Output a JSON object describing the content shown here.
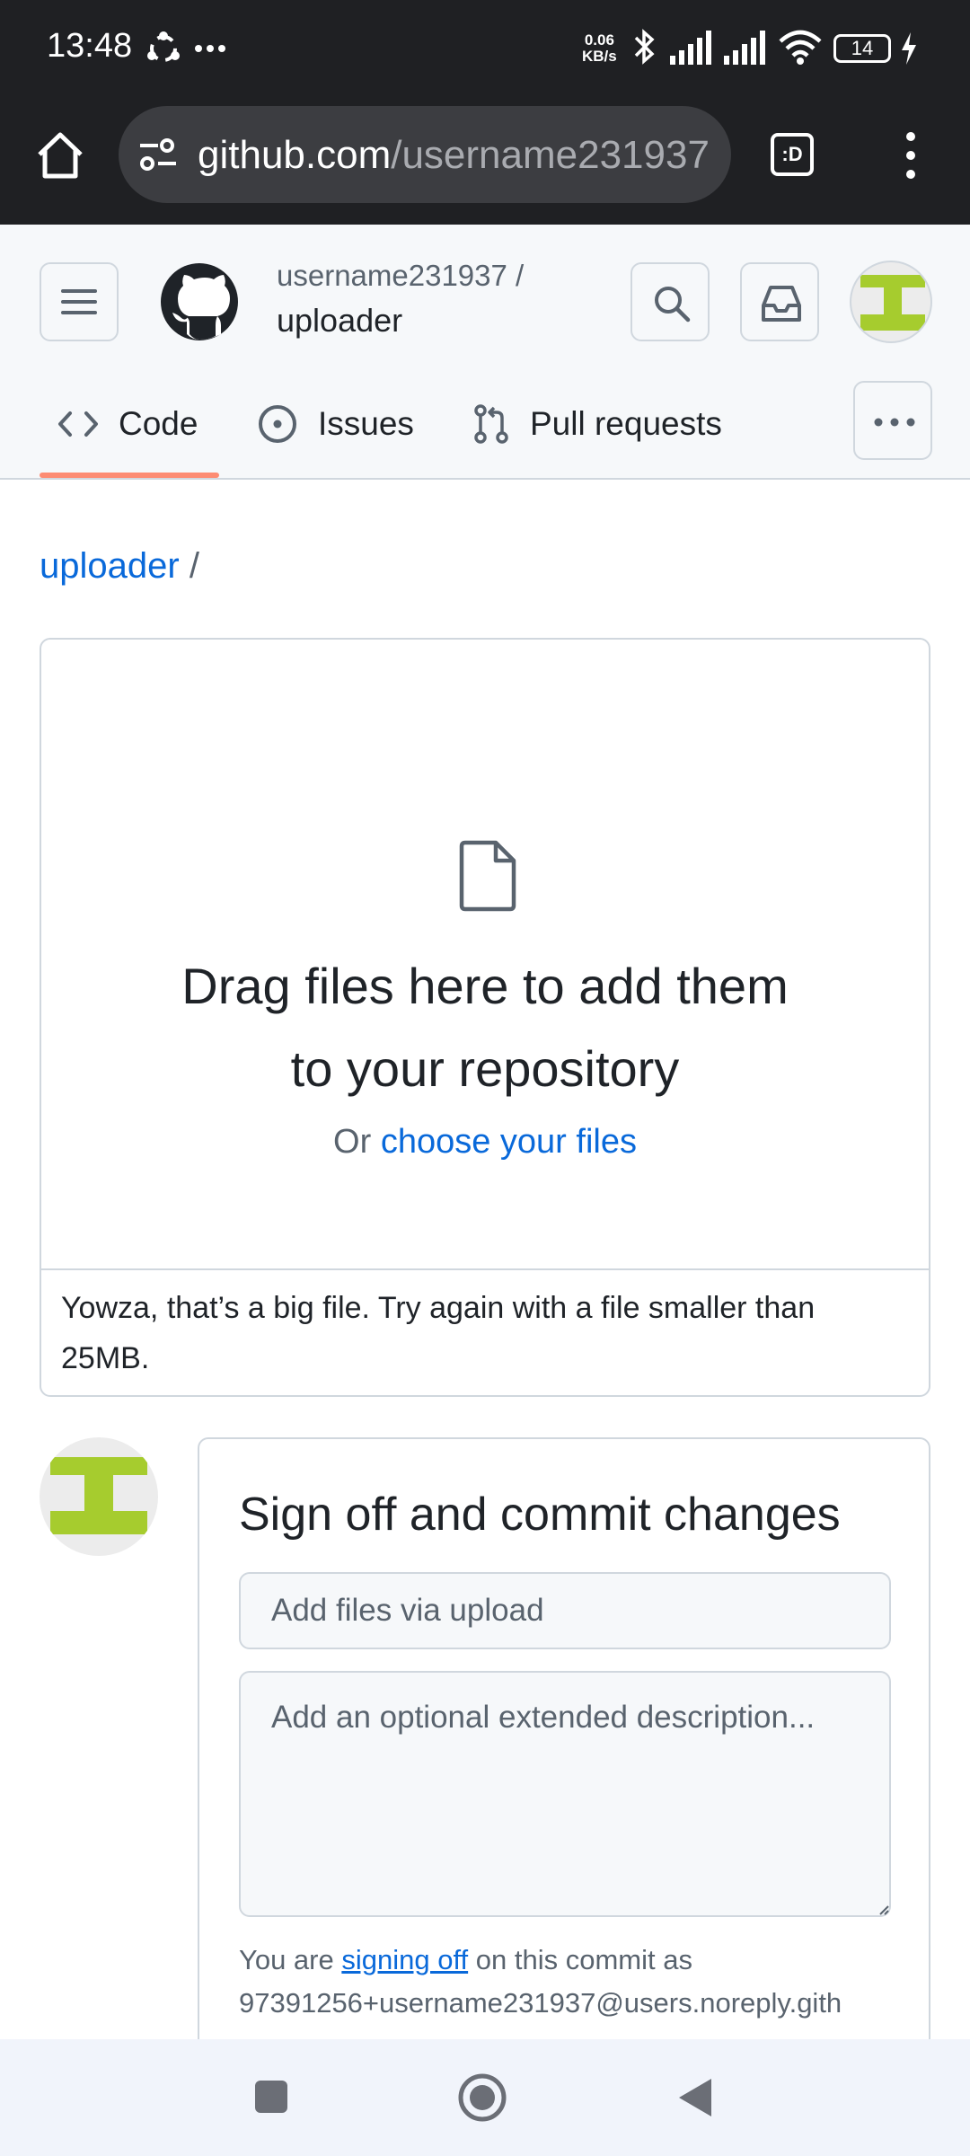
{
  "status_bar": {
    "time": "13:48",
    "net_speed_value": "0.06",
    "net_speed_unit": "KB/s",
    "battery": "14"
  },
  "browser": {
    "url_domain": "github.com",
    "url_path": "/username231937/",
    "tab_button_label": ":D"
  },
  "header": {
    "owner": "username231937 /",
    "repo": "uploader",
    "tabs": [
      {
        "label": "Code"
      },
      {
        "label": "Issues"
      },
      {
        "label": "Pull requests"
      }
    ]
  },
  "breadcrumb": {
    "repo_link": "uploader",
    "separator": "/"
  },
  "dropzone": {
    "title": "Drag files here to add them to your repository",
    "or_text": "Or",
    "choose_link": "choose your files",
    "error": "Yowza, that’s a big file. Try again with a file smaller than 25MB."
  },
  "commit": {
    "title": "Sign off and commit changes",
    "summary_placeholder": "Add files via upload",
    "description_placeholder": "Add an optional extended description...",
    "signoff_prefix": "You are",
    "signoff_link": "signing off",
    "signoff_suffix": "on this commit as",
    "email": "97391256+username231937@users.noreply.gith"
  },
  "colors": {
    "accent_link": "#0969da",
    "tab_underline": "#fd8c73",
    "avatar_green": "#a6cc2e"
  }
}
